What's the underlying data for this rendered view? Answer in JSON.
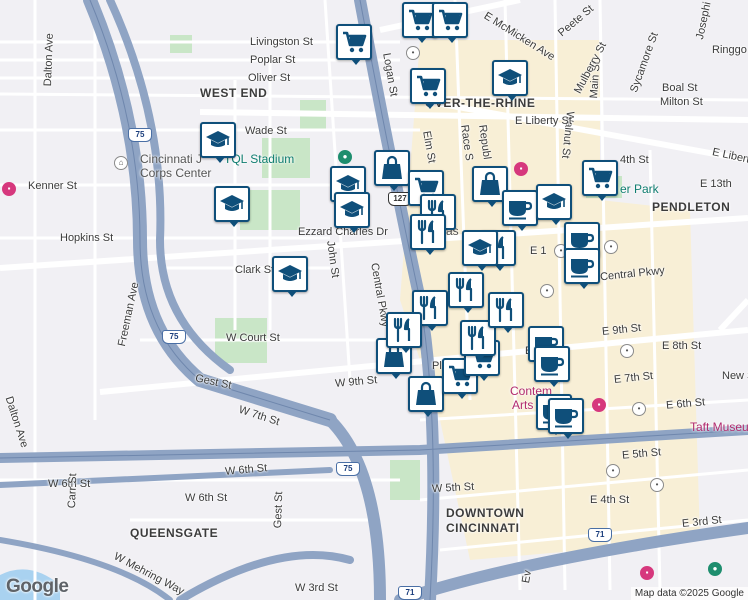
{
  "street_labels": {
    "livingston": "Livingston St",
    "poplar": "Poplar St",
    "oliver": "Oliver St",
    "wade": "Wade St",
    "kenner": "Kenner St",
    "hopkins": "Hopkins St",
    "ezzard": "Ezzard Charles Dr",
    "clark": "Clark St",
    "wcourt": "W Court St",
    "gest": "Gest St",
    "w7th": "W 7th St",
    "w6th_left": "W 6th St",
    "w6th_lower": "W 6th St",
    "w9th": "W 9th St",
    "w6th": "W 6th St",
    "w5th": "W 5th St",
    "w3rd": "W 3rd St",
    "wmehring": "W Mehring Way",
    "freeman": "Freeman Ave",
    "dalton_top": "Dalton Ave",
    "dalton_bottom": "Dalton Ave",
    "carr": "Carr St",
    "gest_v": "Gest St",
    "john": "John St",
    "central": "Central Pkwy",
    "logan": "Logan St",
    "elm": "Elm St",
    "race": "Race S",
    "republic": "Republ",
    "walnut": "Walnut St",
    "main": "Main St",
    "sycamore": "Sycamore St",
    "mcmicken": "E McMicken Ave",
    "mulberry": "Mulberry St",
    "reeke": "Peete St",
    "josephine": "Josephi",
    "ringgold": "Ringgo",
    "eliberty": "E Liberty St",
    "eliberty2": "E Libert",
    "boal": "Boal St",
    "milton": "Milton St",
    "e14th": "4th St",
    "e13th": "E 13th",
    "e1": "E 1",
    "centralpkwy_e": "Central Pkwy",
    "e9th": "E 9th St",
    "e8th": "E 8th St",
    "e7th": "E 7th St",
    "e6th": "E 6th St",
    "e5th": "E 5th St",
    "e4th": "E 4th St",
    "e3rd": "E 3rd St",
    "newst": "New S",
    "e_": "E",
    "pl": "Pl",
    "ev": "Ev"
  },
  "neighborhoods": {
    "west_end": "WEST END",
    "otr": "OVER-THE-RHINE",
    "pendleton": "PENDLETON",
    "queensgate": "QUEENSGATE",
    "downtown_1": "DOWNTOWN",
    "downtown_2": "CINCINNATI"
  },
  "places": {
    "tql": "TQL Stadium",
    "jobcorps_1": "Cincinnati J",
    "jobcorps_2": "Corps Center",
    "park": "er Park",
    "contemporary_1": "Contem",
    "contemporary_2": "Arts",
    "taft": "Taft Museu",
    "as_": "as"
  },
  "shields": {
    "i75_a": "75",
    "i75_b": "75",
    "i75_c": "75",
    "i71_a": "71",
    "i71_b": "71",
    "us127": "127"
  },
  "markers": [
    {
      "icon": "cart-icon",
      "label": "shopping-cart marker"
    },
    {
      "icon": "cart-icon",
      "label": "shopping-cart marker"
    },
    {
      "icon": "cart-icon",
      "label": "shopping-cart marker"
    },
    {
      "icon": "cart-icon",
      "label": "shopping-cart marker"
    },
    {
      "icon": "school-icon",
      "label": "school marker"
    },
    {
      "icon": "school-icon",
      "label": "school marker"
    },
    {
      "icon": "school-icon",
      "label": "school marker"
    },
    {
      "icon": "school-icon",
      "label": "school marker"
    },
    {
      "icon": "school-icon",
      "label": "school marker"
    },
    {
      "icon": "school-icon",
      "label": "school marker"
    },
    {
      "icon": "bag-icon",
      "label": "shopping-bag marker"
    },
    {
      "icon": "bag-icon",
      "label": "shopping-bag marker"
    },
    {
      "icon": "bag-icon",
      "label": "shopping-bag marker"
    },
    {
      "icon": "bag-icon",
      "label": "shopping-bag marker"
    },
    {
      "icon": "cart-icon",
      "label": "shopping-cart marker"
    },
    {
      "icon": "cart-icon",
      "label": "shopping-cart marker"
    },
    {
      "icon": "cart-icon",
      "label": "shopping-cart marker"
    },
    {
      "icon": "cart-icon",
      "label": "shopping-cart marker"
    },
    {
      "icon": "fork-knife-icon",
      "label": "restaurant marker"
    },
    {
      "icon": "fork-knife-icon",
      "label": "restaurant marker"
    },
    {
      "icon": "fork-knife-icon",
      "label": "restaurant marker"
    },
    {
      "icon": "fork-knife-icon",
      "label": "restaurant marker"
    },
    {
      "icon": "fork-knife-icon",
      "label": "restaurant marker"
    },
    {
      "icon": "fork-knife-icon",
      "label": "restaurant marker"
    },
    {
      "icon": "fork-knife-icon",
      "label": "restaurant marker"
    },
    {
      "icon": "fork-knife-icon",
      "label": "restaurant marker"
    },
    {
      "icon": "coffee-icon",
      "label": "cafe marker"
    },
    {
      "icon": "coffee-icon",
      "label": "cafe marker"
    },
    {
      "icon": "coffee-icon",
      "label": "cafe marker"
    },
    {
      "icon": "coffee-icon",
      "label": "cafe marker"
    },
    {
      "icon": "coffee-icon",
      "label": "cafe marker"
    },
    {
      "icon": "coffee-icon",
      "label": "cafe marker"
    },
    {
      "icon": "coffee-icon",
      "label": "cafe marker"
    },
    {
      "icon": "school-icon",
      "label": "school marker"
    },
    {
      "icon": "school-icon",
      "label": "school marker"
    }
  ],
  "footer": {
    "google": "Google",
    "attribution": "Map data ©2025 Google"
  },
  "colors": {
    "marker_border": "#0f4f7a",
    "highway": "#8fa4c4",
    "park": "#c9e6c7",
    "downtown": "#f8efd6",
    "water": "#a9d2f0"
  }
}
